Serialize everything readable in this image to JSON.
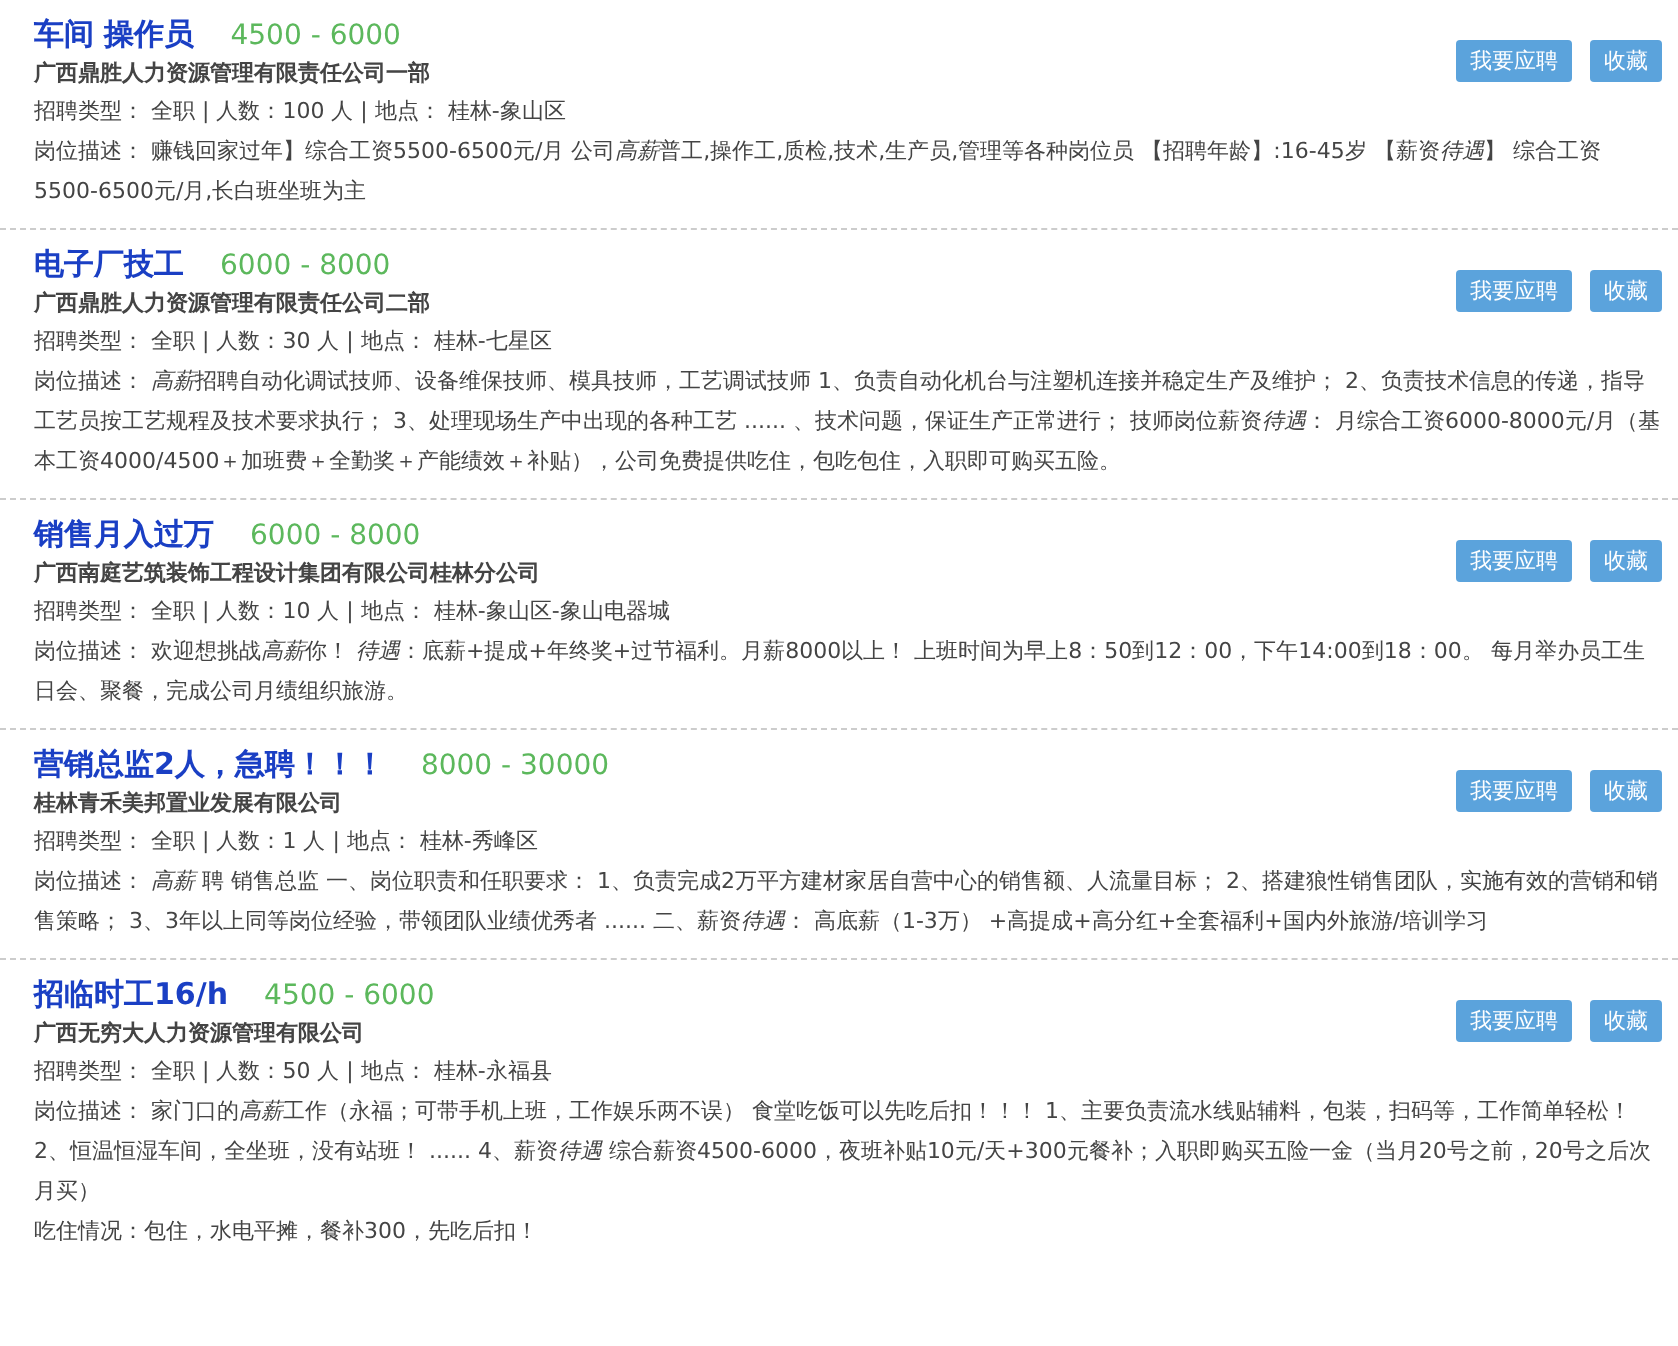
{
  "jobs": [
    {
      "title": "车间 操作员",
      "salary": "4500 - 6000",
      "company": "广西鼎胜人力资源管理有限责任公司一部",
      "meta": "招聘类型： 全职 | 人数：100 人 | 地点： 桂林-象山区",
      "details": [
        [
          {
            "text": "岗位描述： 赚钱回家过年】综合工资5500-6500元/月 公司",
            "italic": false
          },
          {
            "text": "高薪",
            "italic": true
          },
          {
            "text": "普工,操作工,质检,技术,生产员,管理等各种岗位员 【招聘年龄】:16-45岁 【薪资",
            "italic": false
          },
          {
            "text": "待遇",
            "italic": true
          },
          {
            "text": "】 综合工资5500-6500元/月,长白班坐班为主",
            "italic": false
          }
        ]
      ],
      "buttons": [
        "我要应聘",
        "收藏"
      ]
    },
    {
      "title": "电子厂技工",
      "salary": "6000 - 8000",
      "company": "广西鼎胜人力资源管理有限责任公司二部",
      "meta": "招聘类型： 全职 | 人数：30 人 | 地点： 桂林-七星区",
      "details": [
        [
          {
            "text": "岗位描述： ",
            "italic": false
          },
          {
            "text": "高薪",
            "italic": true
          },
          {
            "text": "招聘自动化调试技师、设备维保技师、模具技师，工艺调试技师 1、负责自动化机台与注塑机连接并稳定生产及维护； 2、负责技术信息的传递，指导工艺员按工艺规程及技术要求执行； 3、处理现场生产中出现的各种工艺 ...... 、技术问题，保证生产正常进行； 技师岗位薪资",
            "italic": false
          },
          {
            "text": "待遇",
            "italic": true
          },
          {
            "text": "： 月综合工资6000-8000元/月（基本工资4000/4500＋加班费＋全勤奖＋产能绩效＋补贴），公司免费提供吃住，包吃包住，入职即可购买五险。",
            "italic": false
          }
        ]
      ],
      "buttons": [
        "我要应聘",
        "收藏"
      ]
    },
    {
      "title": "销售月入过万",
      "salary": "6000 - 8000",
      "company": "广西南庭艺筑装饰工程设计集团有限公司桂林分公司",
      "meta": "招聘类型： 全职 | 人数：10 人 | 地点： 桂林-象山区-象山电器城",
      "details": [
        [
          {
            "text": "岗位描述： 欢迎想挑战",
            "italic": false
          },
          {
            "text": "高薪",
            "italic": true
          },
          {
            "text": "你！ ",
            "italic": false
          },
          {
            "text": "待遇",
            "italic": true
          },
          {
            "text": "：底薪+提成+年终奖+过节福利。月薪8000以上！ 上班时间为早上8：50到12：00，下午14:00到18：00。 每月举办员工生日会、聚餐，完成公司月绩组织旅游。",
            "italic": false
          }
        ]
      ],
      "buttons": [
        "我要应聘",
        "收藏"
      ]
    },
    {
      "title": "营销总监2人，急聘！！！",
      "salary": "8000 - 30000",
      "company": "桂林青禾美邦置业发展有限公司",
      "meta": "招聘类型： 全职 | 人数：1 人 | 地点： 桂林-秀峰区",
      "details": [
        [
          {
            "text": "岗位描述： ",
            "italic": false
          },
          {
            "text": "高薪",
            "italic": true
          },
          {
            "text": " 聘 销售总监 一、岗位职责和任职要求： 1、负责完成2万平方建材家居自营中心的销售额、人流量目标； 2、搭建狼性销售团队，实施有效的营销和销售策略； 3、3年以上同等岗位经验，带领团队业绩优秀者 ...... 二、薪资",
            "italic": false
          },
          {
            "text": "待遇",
            "italic": true
          },
          {
            "text": "： 高底薪（1-3万） +高提成+高分红+全套福利+国内外旅游/培训学习",
            "italic": false
          }
        ]
      ],
      "buttons": [
        "我要应聘",
        "收藏"
      ]
    },
    {
      "title": "招临时工16/h",
      "salary": "4500 - 6000",
      "company": "广西无穷大人力资源管理有限公司",
      "meta": "招聘类型： 全职 | 人数：50 人 | 地点： 桂林-永福县",
      "details": [
        [
          {
            "text": "岗位描述： 家门口的",
            "italic": false
          },
          {
            "text": "高薪",
            "italic": true
          },
          {
            "text": "工作（永福；可带手机上班，工作娱乐两不误） 食堂吃饭可以先吃后扣！！！ 1、主要负责流水线贴辅料，包装，扫码等，工作简单轻松！ 2、恒温恒湿车间，全坐班，没有站班！ ...... 4、薪资",
            "italic": false
          },
          {
            "text": "待遇",
            "italic": true
          },
          {
            "text": " 综合薪资4500-6000，夜班补贴10元/天+300元餐补；入职即购买五险一金（当月20号之前，20号之后次月买）",
            "italic": false
          }
        ],
        [
          {
            "text": "吃住情况：包住，水电平摊，餐补300，先吃后扣！",
            "italic": false
          }
        ]
      ],
      "buttons": [
        "我要应聘",
        "收藏"
      ]
    }
  ]
}
